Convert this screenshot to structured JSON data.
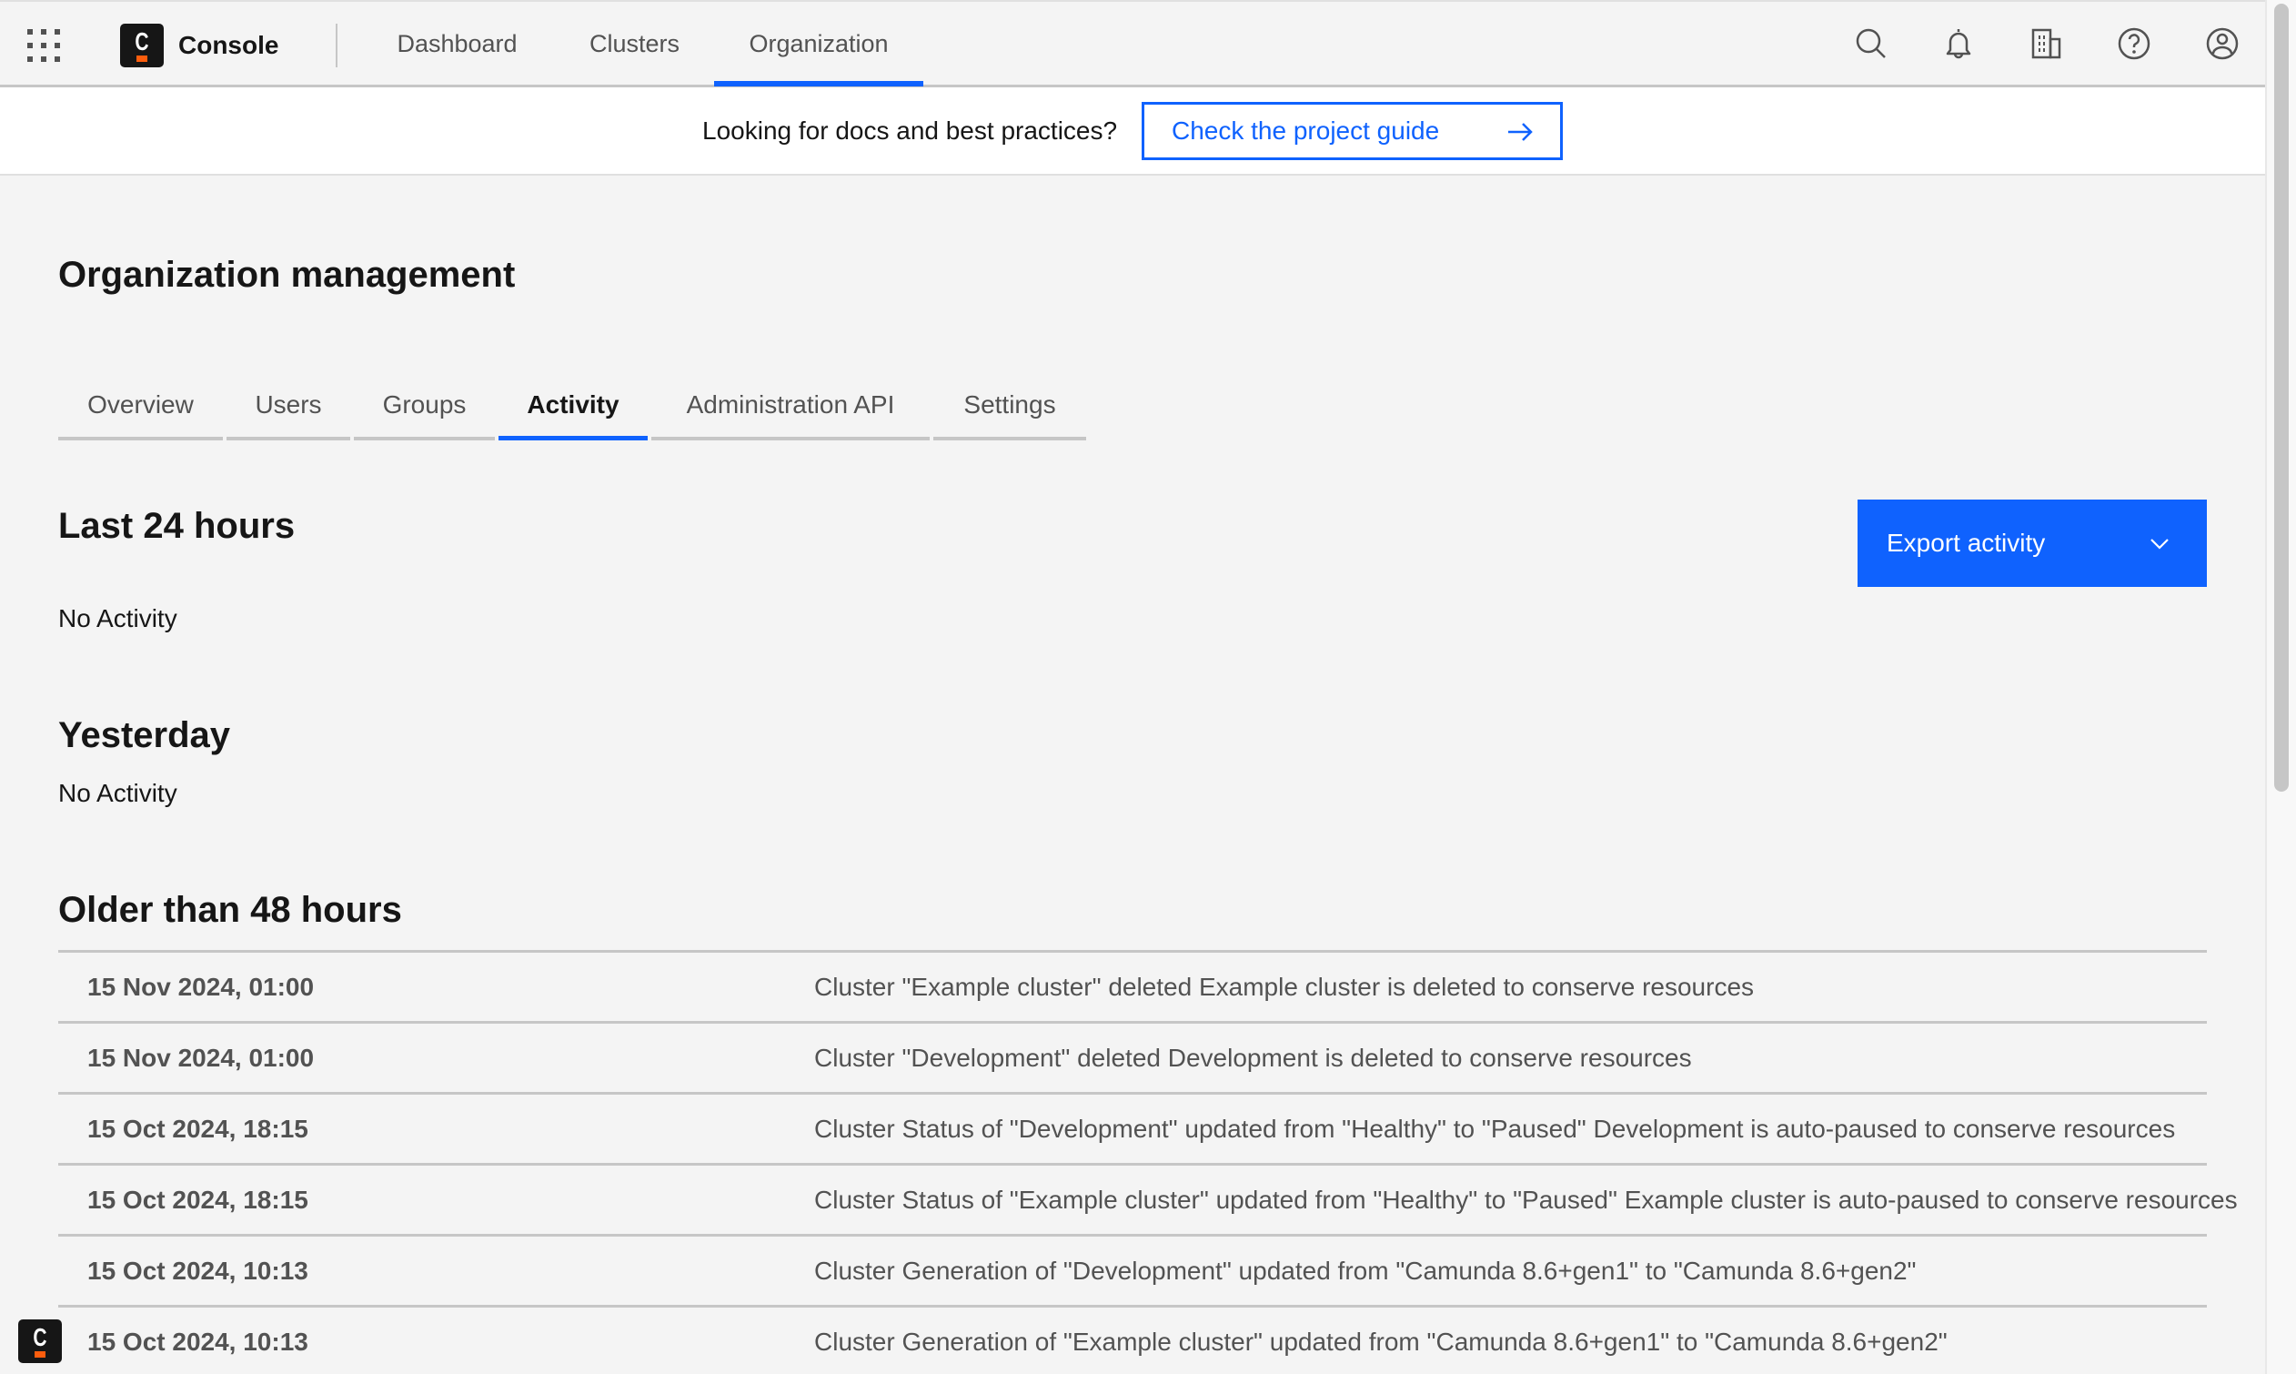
{
  "topnav": {
    "brand": "Console",
    "links": [
      {
        "label": "Dashboard",
        "active": false
      },
      {
        "label": "Clusters",
        "active": false
      },
      {
        "label": "Organization",
        "active": true
      }
    ],
    "icons": [
      "search-icon",
      "notification-bell-icon",
      "organization-building-icon",
      "help-icon",
      "user-avatar-icon"
    ]
  },
  "banner": {
    "text": "Looking for docs and best practices?",
    "button_label": "Check the project guide"
  },
  "page": {
    "title": "Organization management",
    "tabs": [
      {
        "label": "Overview",
        "active": false
      },
      {
        "label": "Users",
        "active": false
      },
      {
        "label": "Groups",
        "active": false
      },
      {
        "label": "Activity",
        "active": true
      },
      {
        "label": "Administration API",
        "active": false
      },
      {
        "label": "Settings",
        "active": false
      }
    ],
    "export_button": "Export activity"
  },
  "sections": {
    "last24": {
      "title": "Last 24 hours",
      "empty": "No Activity"
    },
    "yesterday": {
      "title": "Yesterday",
      "empty": "No Activity"
    },
    "older": {
      "title": "Older than 48 hours"
    }
  },
  "activity": [
    {
      "date": "15 Nov 2024, 01:00",
      "description": "Cluster \"Example cluster\" deleted Example cluster is deleted to conserve resources"
    },
    {
      "date": "15 Nov 2024, 01:00",
      "description": "Cluster \"Development\" deleted Development is deleted to conserve resources"
    },
    {
      "date": "15 Oct 2024, 18:15",
      "description": "Cluster Status of \"Development\" updated from \"Healthy\" to \"Paused\" Development is auto-paused to conserve resources"
    },
    {
      "date": "15 Oct 2024, 18:15",
      "description": "Cluster Status of \"Example cluster\" updated from \"Healthy\" to \"Paused\" Example cluster is auto-paused to conserve resources"
    },
    {
      "date": "15 Oct 2024, 10:13",
      "description": "Cluster Generation of \"Development\" updated from \"Camunda 8.6+gen1\" to \"Camunda 8.6+gen2\""
    },
    {
      "date": "15 Oct 2024, 10:13",
      "description": "Cluster Generation of \"Example cluster\" updated from \"Camunda 8.6+gen1\" to \"Camunda 8.6+gen2\""
    }
  ],
  "colors": {
    "accent": "#0f62fe",
    "brand_orange": "#fc5d0d",
    "background": "#f4f4f4",
    "text_primary": "#161616",
    "text_secondary": "#525252",
    "divider": "#c6c6c6"
  }
}
